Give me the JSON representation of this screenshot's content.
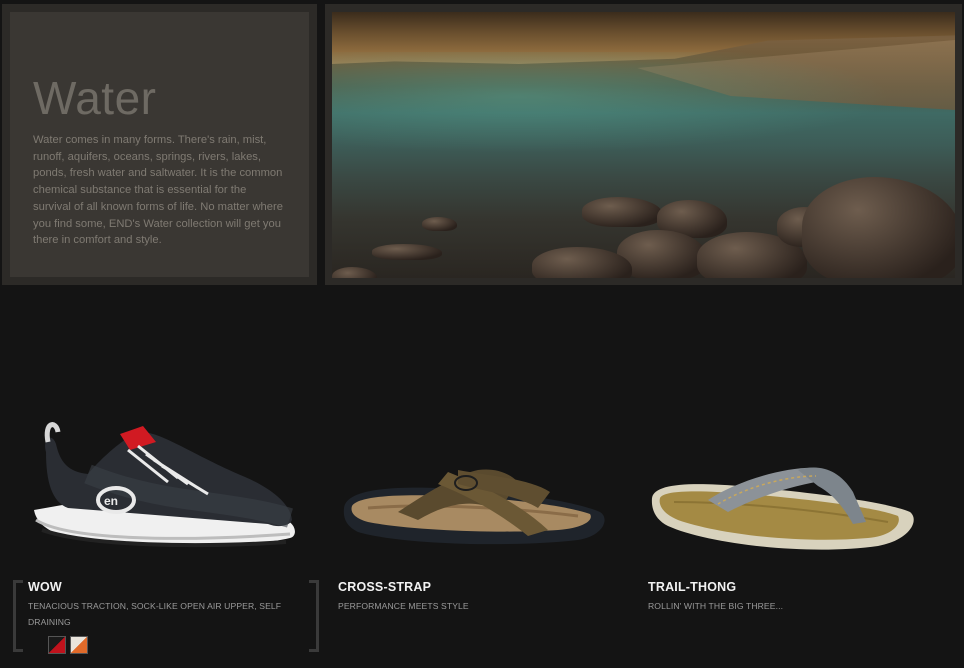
{
  "intro": {
    "title": "Water",
    "text": "Water comes in many forms. There's rain, mist, runoff, aquifers, oceans, springs, rivers, lakes, ponds, fresh water and saltwater. It is the common chemical substance that is essential for the survival of all known forms of life. No matter where you find some, END's Water collection will get you there in comfort and style."
  },
  "products": [
    {
      "name": "WOW",
      "description": "TENACIOUS TRACTION, SOCK-LIKE OPEN AIR UPPER, SELF DRAINING",
      "swatches": [
        {
          "color": "#c0121c"
        },
        {
          "color": "#e06a2a"
        }
      ]
    },
    {
      "name": "CROSS-STRAP",
      "description": "PERFORMANCE MEETS STYLE"
    },
    {
      "name": "TRAIL-THONG",
      "description": "ROLLIN' WITH THE BIG THREE..."
    }
  ],
  "colors": {
    "background": "#141414",
    "panel": "#3a3733",
    "accent": "#c0121c"
  }
}
